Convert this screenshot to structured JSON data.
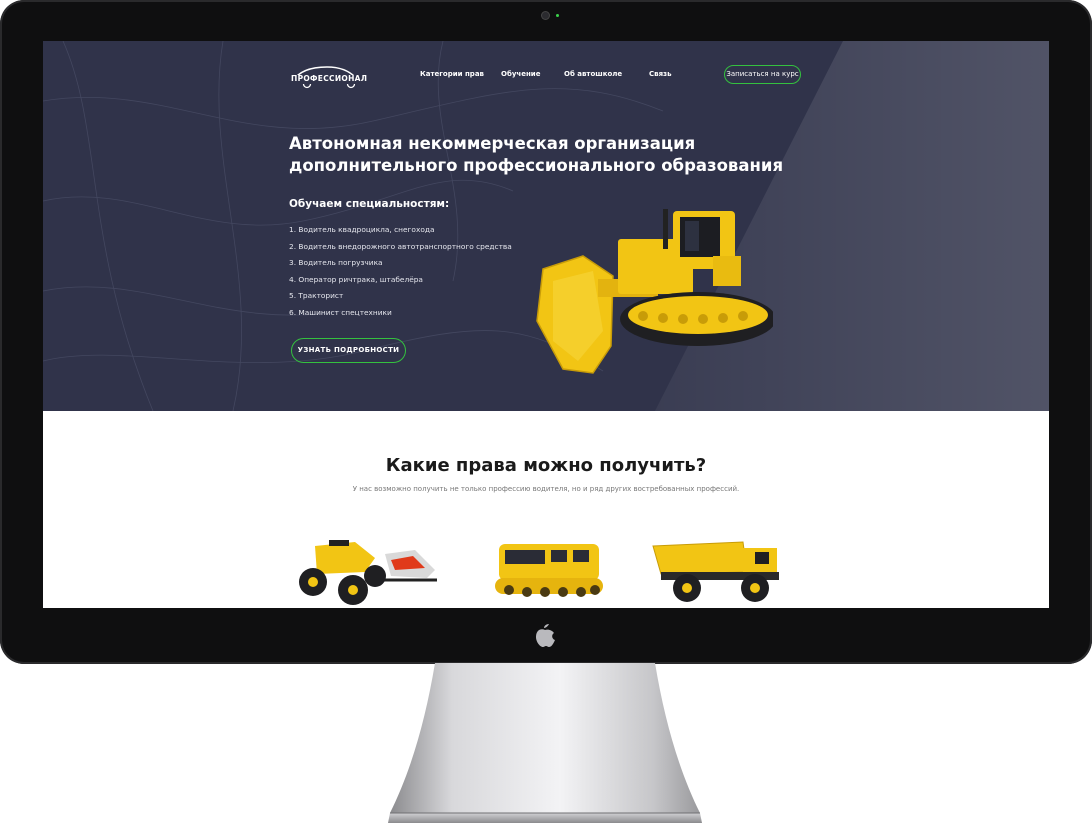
{
  "site": {
    "logo_text": "ПРОФЕССИОНАЛ",
    "nav": [
      "Категории прав",
      "Обучение",
      "Об автошколе",
      "Связь"
    ],
    "cta_top": "Записаться на курс"
  },
  "hero": {
    "headline_line1": "Автономная некоммерческая организация",
    "headline_line2": "дополнительного профессионального образования",
    "subhead": "Обучаем специальностям:",
    "specialties": [
      "1. Водитель квадроцикла, снегохода",
      "2. Водитель внедорожного автотранспортного средства",
      "3. Водитель погрузчика",
      "4. Оператор ричтрака, штабелёра",
      "5. Тракторист",
      "6. Машинист спецтехники"
    ],
    "button": "УЗНАТЬ ПОДРОБНОСТИ"
  },
  "licenses": {
    "title": "Какие права можно получить?",
    "subtitle": "У нас возможно получить не только профессию водителя, но и ряд других востребованных профессий."
  },
  "colors": {
    "hero_bg": "#30334a",
    "accent_green": "#34c13f",
    "machine_yellow": "#f2c514"
  },
  "icons": [
    "apple-icon",
    "camera-icon"
  ]
}
